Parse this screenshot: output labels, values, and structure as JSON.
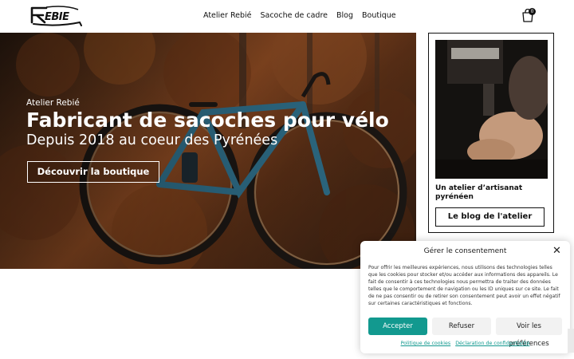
{
  "brand": {
    "logo_text": "REBIE",
    "logo_icon": "rebie-logo"
  },
  "nav": {
    "items": [
      {
        "label": "Atelier Rebié"
      },
      {
        "label": "Sacoche de cadre"
      },
      {
        "label": "Blog"
      },
      {
        "label": "Boutique"
      }
    ],
    "cart_icon": "shopping-bag-icon",
    "cart_count": "0"
  },
  "hero": {
    "kicker": "Atelier Rebié",
    "title": "Fabricant de sacoches pour vélo",
    "subtitle": "Depuis 2018 au coeur des Pyrénées",
    "cta_label": "Découvrir la boutique"
  },
  "card": {
    "title": "Un atelier d’artisanat pyrénéen",
    "cta_label": "Le blog de l'atelier"
  },
  "consent": {
    "title": "Gérer le consentement",
    "body": "Pour offrir les meilleures expériences, nous utilisons des technologies telles que les cookies pour stocker et/ou accéder aux informations des appareils. Le fait de consentir à ces technologies nous permettra de traiter des données telles que le comportement de navigation ou les ID uniques sur ce site. Le fait de ne pas consentir ou de retirer son consentement peut avoir un effet négatif sur certaines caractéristiques et fonctions.",
    "accept_label": "Accepter",
    "refuse_label": "Refuser",
    "prefs_label": "Voir les préférences",
    "cookie_policy_label": "Politique de cookies",
    "privacy_label": "Déclaration de confidentialité",
    "accent_color": "#12998f"
  }
}
